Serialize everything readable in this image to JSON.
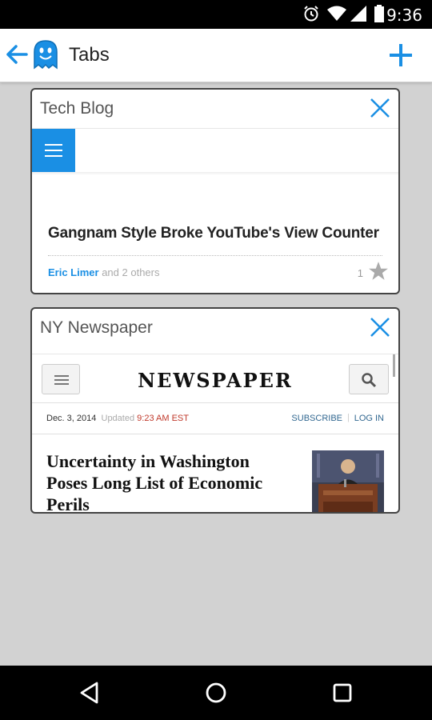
{
  "status_bar": {
    "time": "9:36",
    "icons": [
      "alarm-icon",
      "wifi-icon",
      "signal-icon",
      "battery-icon"
    ]
  },
  "app_bar": {
    "title": "Tabs",
    "back_icon": "arrow-left-icon",
    "logo_icon": "ghost-icon",
    "add_icon": "plus-icon",
    "accent_color": "#1a8fe4"
  },
  "tabs": [
    {
      "title": "Tech Blog",
      "preview": {
        "headline": "Gangnam Style Broke YouTube's View Counter",
        "author": "Eric Limer",
        "author_suffix": " and 2 others",
        "like_count": "1"
      }
    },
    {
      "title": "NY Newspaper",
      "preview": {
        "logo": "NEWSPAPER",
        "date": "Dec. 3, 2014",
        "updated_label": "Updated",
        "updated_time": "9:23 AM EST",
        "subscribe": "SUBSCRIBE",
        "separator": "|",
        "login": "LOG IN",
        "headline": "Uncertainty in Washington Poses Long List of Economic Perils"
      }
    }
  ],
  "nav_bar": {
    "icons": [
      "back-triangle-icon",
      "home-circle-icon",
      "recents-square-icon"
    ]
  }
}
